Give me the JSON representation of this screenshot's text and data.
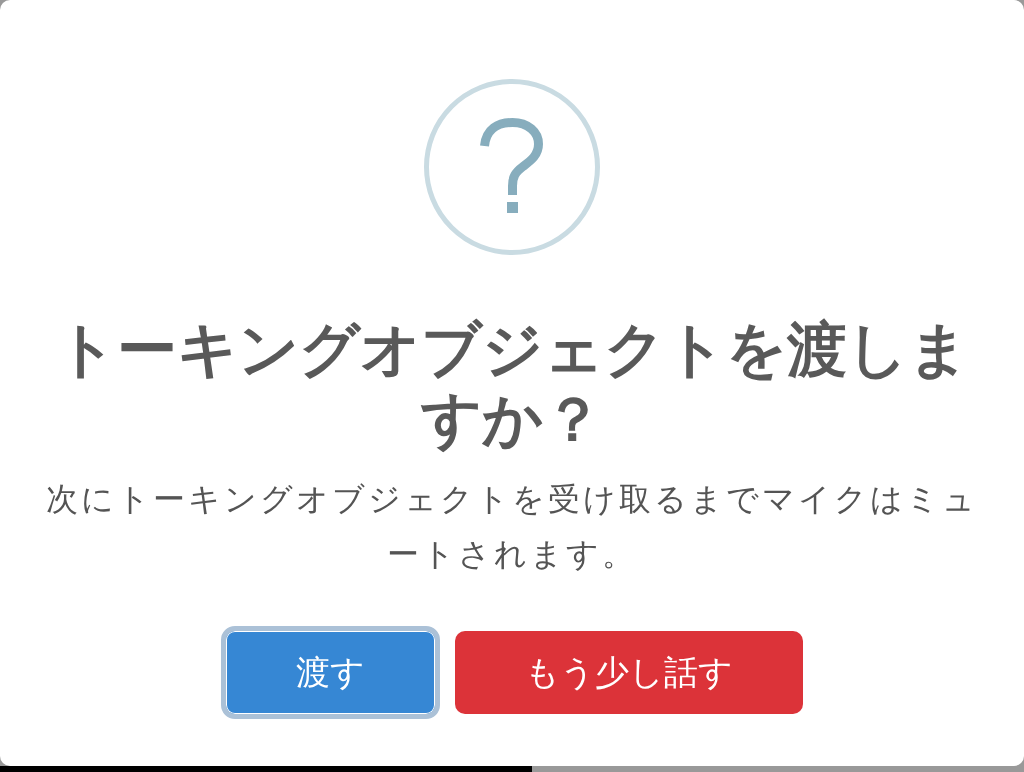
{
  "dialog": {
    "icon": {
      "kind": "question"
    },
    "title": "トーキングオブジェクトを渡しますか？",
    "text": "次にトーキングオブジェクトを受け取るまでマイクはミュートされます。",
    "buttons": [
      {
        "label": "渡す",
        "kind": "confirm",
        "focused": true
      },
      {
        "label": "もう少し話す",
        "kind": "cancel",
        "focused": false
      }
    ]
  }
}
